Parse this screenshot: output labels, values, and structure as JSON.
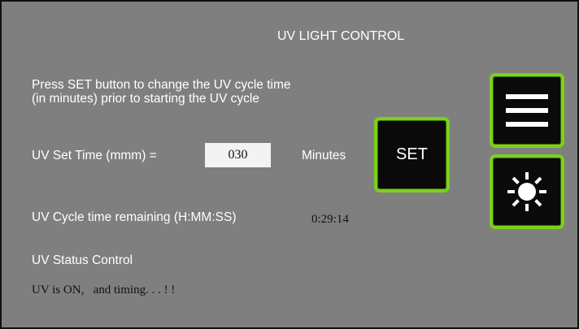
{
  "header": {
    "title": "UV LIGHT CONTROL"
  },
  "instructions": {
    "line1": "Press SET button to change the UV cycle time",
    "line2": "(in minutes) prior to starting the UV cycle"
  },
  "set_time": {
    "label": "UV Set Time (mmm) =",
    "value": "030",
    "unit": "Minutes"
  },
  "set_button": {
    "label": "SET"
  },
  "remaining": {
    "label": "UV Cycle time remaining (H:MM:SS)",
    "value": "0:29:14"
  },
  "status": {
    "heading": "UV Status Control",
    "message": "UV is ON,   and timing. . . ! !"
  },
  "side_buttons": {
    "menu_icon": "hamburger-menu-icon",
    "uv_icon": "sun-icon"
  },
  "colors": {
    "background": "#7f7f7f",
    "button_fill": "#0a0a0a",
    "button_border": "#7bd11a",
    "text_light": "#ffffff",
    "text_dark": "#111111",
    "input_fill": "#f3f3f3"
  }
}
